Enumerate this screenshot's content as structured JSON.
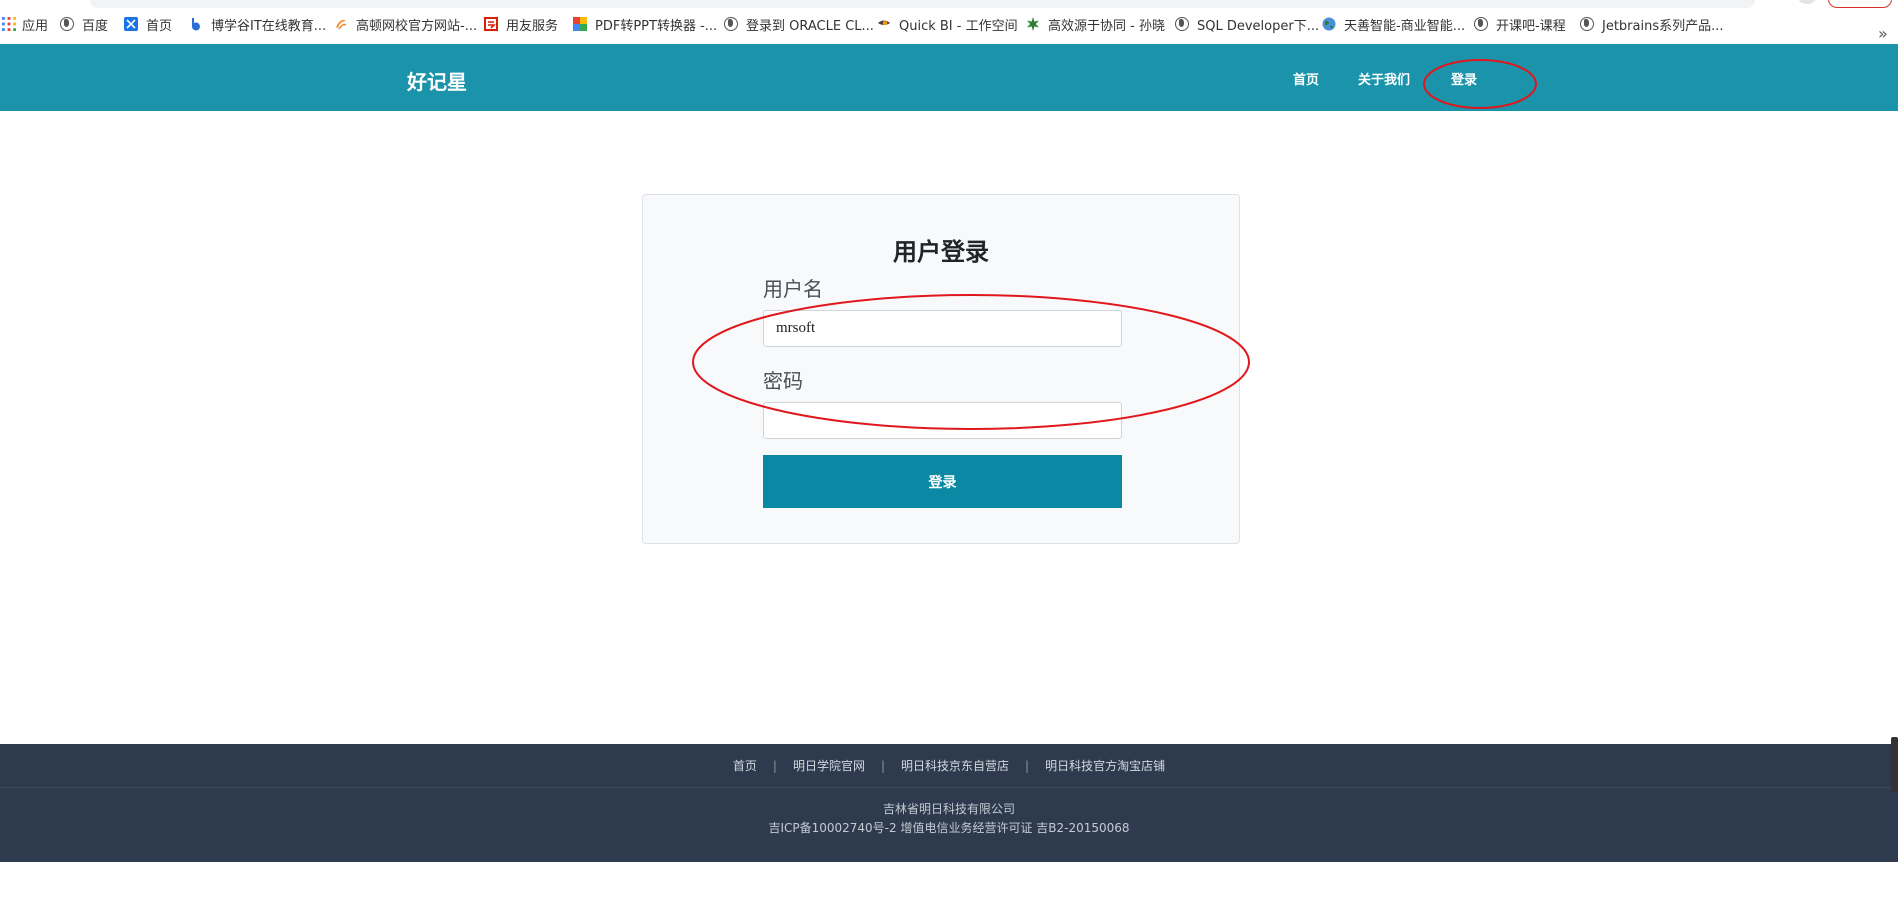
{
  "bookmarks": [
    {
      "label": "应用",
      "icon": "apps-grid-icon",
      "color": "#4285f4"
    },
    {
      "label": "百度",
      "icon": "globe-icon",
      "color": "#555555"
    },
    {
      "label": "首页",
      "icon": "bookmark-k-icon",
      "color": "#1a73e8"
    },
    {
      "label": "博学谷IT在线教育...",
      "icon": "bxg-logo-icon",
      "color": "#2a6fd6"
    },
    {
      "label": "高顿网校官方网站-...",
      "icon": "gaodun-logo-icon",
      "color": "#f08a24"
    },
    {
      "label": "用友服务",
      "icon": "yonyou-logo-icon",
      "color": "#d81e06"
    },
    {
      "label": "PDF转PPT转换器 -...",
      "icon": "pdf-tool-icon",
      "color": "#e94235"
    },
    {
      "label": "登录到 ORACLE CL...",
      "icon": "globe-icon",
      "color": "#555555"
    },
    {
      "label": "Quick BI - 工作空间",
      "icon": "quickbi-logo-icon",
      "color": "#ff9800"
    },
    {
      "label": "高效源于协同 - 孙晓",
      "icon": "star-gear-icon",
      "color": "#2e7d32"
    },
    {
      "label": "SQL Developer下...",
      "icon": "globe-icon",
      "color": "#555555"
    },
    {
      "label": "天善智能-商业智能...",
      "icon": "earth-icon",
      "color": "#2e7d32"
    },
    {
      "label": "开课吧-课程",
      "icon": "globe-icon",
      "color": "#555555"
    },
    {
      "label": "Jetbrains系列产品...",
      "icon": "globe-icon",
      "color": "#555555"
    }
  ],
  "more_bookmarks": "»",
  "header": {
    "brand": "好记星",
    "nav": [
      "首页",
      "关于我们",
      "登录"
    ],
    "bg_color": "#1a93ab"
  },
  "login": {
    "title": "用户登录",
    "username_label": "用户名",
    "username_value": "mrsoft",
    "password_label": "密码",
    "password_value": "",
    "submit_label": "登录",
    "button_color": "#0b88a3"
  },
  "footer": {
    "links": [
      "首页",
      "明日学院官网",
      "明日科技京东自营店",
      "明日科技官方淘宝店铺"
    ],
    "separator": "|",
    "company": "吉林省明日科技有限公司",
    "license": "吉ICP备10002740号-2  增值电信业务经营许可证 吉B2-20150068",
    "bg_color": "#2e3b4e"
  },
  "annotations": {
    "color": "#e0171c"
  }
}
